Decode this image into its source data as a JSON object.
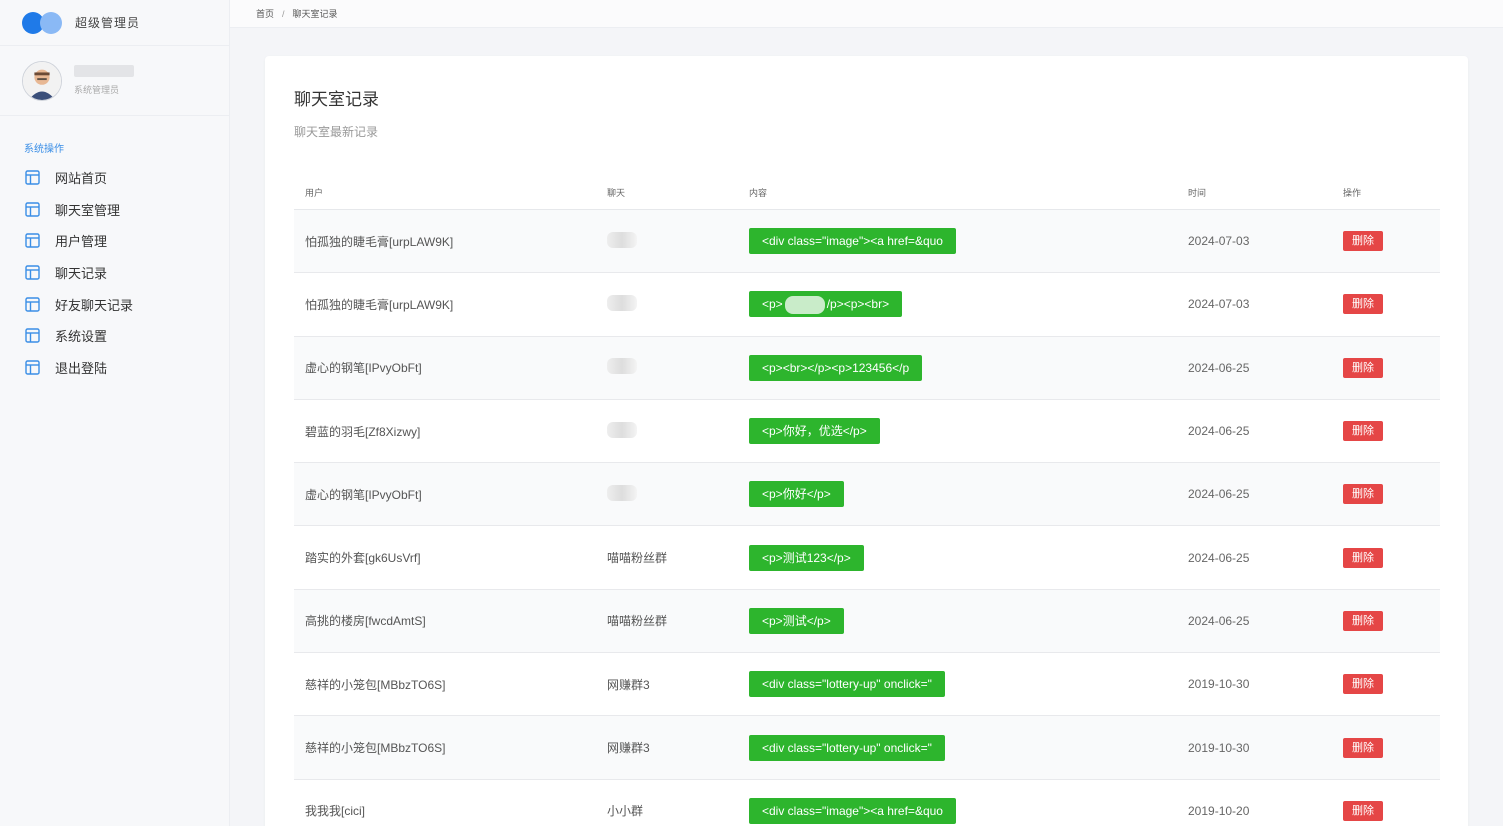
{
  "brand": {
    "name": "超级管理员"
  },
  "user": {
    "role": "系统管理员"
  },
  "nav": {
    "title": "系统操作",
    "items": [
      {
        "label": "网站首页"
      },
      {
        "label": "聊天室管理"
      },
      {
        "label": "用户管理"
      },
      {
        "label": "聊天记录"
      },
      {
        "label": "好友聊天记录"
      },
      {
        "label": "系统设置"
      },
      {
        "label": "退出登陆"
      }
    ]
  },
  "breadcrumb": {
    "home": "首页",
    "separator": "/",
    "current": "聊天室记录"
  },
  "card": {
    "title": "聊天室记录",
    "subtitle": "聊天室最新记录"
  },
  "table": {
    "headers": {
      "user": "用户",
      "chat": "聊天",
      "content": "内容",
      "time": "时间",
      "op": "操作"
    },
    "delete_label": "删除",
    "rows": [
      {
        "user": "怕孤独的睫毛膏[urpLAW9K]",
        "chat": "",
        "content": "<div class=\"image\"><a href=&quo",
        "time": "2024-07-03"
      },
      {
        "user": "怕孤独的睫毛膏[urpLAW9K]",
        "chat": "",
        "content_a": "<p>",
        "content_b": "/p><p><br>",
        "time": "2024-07-03"
      },
      {
        "user": "虚心的钢笔[IPvyObFt]",
        "chat": "",
        "content": "<p><br></p><p>123456</p",
        "time": "2024-06-25"
      },
      {
        "user": "碧蓝的羽毛[Zf8Xizwy]",
        "chat": "",
        "content": "<p>你好，优选</p>",
        "time": "2024-06-25"
      },
      {
        "user": "虚心的钢笔[IPvyObFt]",
        "chat": "",
        "content": "<p>你好</p>",
        "time": "2024-06-25"
      },
      {
        "user": "踏实的外套[gk6UsVrf]",
        "chat": "喵喵粉丝群",
        "content": "<p>测试123</p>",
        "time": "2024-06-25"
      },
      {
        "user": "高挑的楼房[fwcdAmtS]",
        "chat": "喵喵粉丝群",
        "content": "<p>测试</p>",
        "time": "2024-06-25"
      },
      {
        "user": "慈祥的小笼包[MBbzTO6S]",
        "chat": "网赚群3",
        "content": "<div class=\"lottery-up\" onclick=\"",
        "time": "2019-10-30"
      },
      {
        "user": "慈祥的小笼包[MBbzTO6S]",
        "chat": "网赚群3",
        "content": "<div class=\"lottery-up\" onclick=\"",
        "time": "2019-10-30"
      },
      {
        "user": "我我我[cici]",
        "chat": "小小群",
        "content": "<div class=\"image\"><a href=&quo",
        "time": "2019-10-20"
      }
    ]
  },
  "colors": {
    "accent": "#1f7ae8",
    "pill": "#2db52d",
    "danger": "#e54646"
  }
}
